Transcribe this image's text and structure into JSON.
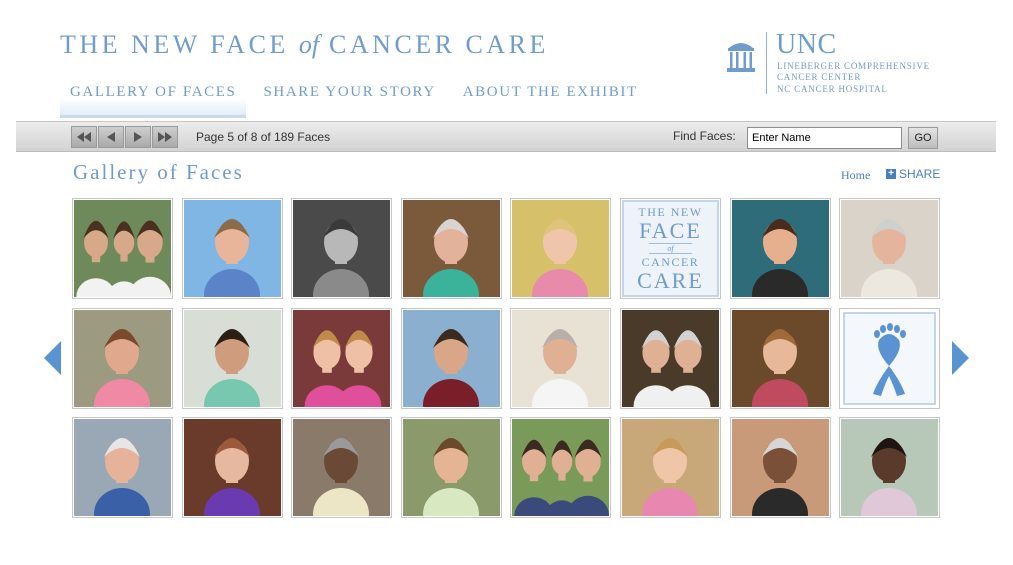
{
  "header": {
    "title_part1": "THE NEW FACE ",
    "title_of": "of",
    "title_part2": " CANCER CARE",
    "nav": [
      {
        "label": "GALLERY OF FACES",
        "active": true
      },
      {
        "label": "SHARE YOUR STORY",
        "active": false
      },
      {
        "label": "ABOUT THE EXHIBIT",
        "active": false
      }
    ],
    "logo": {
      "name": "UNC",
      "line1": "LINEBERGER COMPREHENSIVE",
      "line2": "CANCER CENTER",
      "line3": "NC CANCER HOSPITAL",
      "icon": "old-well-icon"
    }
  },
  "toolbar": {
    "page_info": "Page 5 of 8 of 189 Faces",
    "find_label": "Find Faces:",
    "find_value": "Enter Name",
    "go_label": "GO"
  },
  "content": {
    "heading": "Gallery of Faces",
    "home_link": "Home",
    "share_link": "SHARE"
  },
  "colors": {
    "accent": "#6f9bcd",
    "link": "#4a7fbf",
    "toolbar": "#dcdcdc"
  },
  "gallery": {
    "rows": 3,
    "columns": 8,
    "tiles": [
      {
        "type": "photo",
        "bg": "#6f8a5a",
        "skin": "#d7a98a",
        "hair": "#4a3020",
        "shirt": "#f2f2f2",
        "people": 3
      },
      {
        "type": "photo",
        "bg": "#7fb6e3",
        "skin": "#e8b49a",
        "hair": "#8a6b4a",
        "shirt": "#5b84c8"
      },
      {
        "type": "photo",
        "bg": "#4a4a4a",
        "skin": "#b8b8b8",
        "hair": "#3a3a3a",
        "shirt": "#8a8a8a"
      },
      {
        "type": "photo",
        "bg": "#7a5a3a",
        "skin": "#e3b29a",
        "hair": "#d9d4cf",
        "shirt": "#3ab39a"
      },
      {
        "type": "photo",
        "bg": "#d6c06a",
        "skin": "#f0c6aa",
        "hair": "#e1c27a",
        "shirt": "#e88aaa"
      },
      {
        "type": "logo",
        "line1": "THE NEW",
        "line2": "FACE",
        "line3": "of",
        "line4": "CANCER",
        "line5": "CARE"
      },
      {
        "type": "photo",
        "bg": "#2f6c7a",
        "skin": "#e6b08e",
        "hair": "#4a2c1c",
        "shirt": "#2a2a2a"
      },
      {
        "type": "photo",
        "bg": "#d9d3c9",
        "skin": "#e4b59c",
        "hair": "#cfcfcf",
        "shirt": "#ece8df"
      },
      {
        "type": "photo",
        "bg": "#9c9a80",
        "skin": "#e0a98e",
        "hair": "#7a4a2c",
        "shirt": "#f08aa4"
      },
      {
        "type": "photo",
        "bg": "#d8ddd6",
        "skin": "#cf9d7e",
        "hair": "#2c1e14",
        "shirt": "#78c8b0"
      },
      {
        "type": "photo",
        "bg": "#7a3a3a",
        "skin": "#f0c0a6",
        "hair": "#c08a4a",
        "shirt": "#e0509a",
        "people": 2
      },
      {
        "type": "photo",
        "bg": "#8bb0cf",
        "skin": "#d9a688",
        "hair": "#3a2a20",
        "shirt": "#7a1e2a"
      },
      {
        "type": "photo",
        "bg": "#e8e2d4",
        "skin": "#e0b094",
        "hair": "#b8b0a8",
        "shirt": "#f5f5f5"
      },
      {
        "type": "photo",
        "bg": "#4a3a2a",
        "skin": "#e0b094",
        "hair": "#d2d2d2",
        "shirt": "#f0f0f0",
        "people": 2
      },
      {
        "type": "photo",
        "bg": "#6a4a2a",
        "skin": "#e8b89a",
        "hair": "#a06a3a",
        "shirt": "#c04a60"
      },
      {
        "type": "ribbon",
        "color": "#5a93d1"
      },
      {
        "type": "photo",
        "bg": "#9aa8b6",
        "skin": "#e6b29a",
        "hair": "#e6e6e6",
        "shirt": "#3a60a8"
      },
      {
        "type": "photo",
        "bg": "#6a3a2a",
        "skin": "#e6b8a0",
        "hair": "#9a5a3a",
        "shirt": "#6a3ab0"
      },
      {
        "type": "photo",
        "bg": "#8a7a6a",
        "skin": "#6a4a36",
        "hair": "#9a9a9a",
        "shirt": "#ece6c6"
      },
      {
        "type": "photo",
        "bg": "#8a9a6a",
        "skin": "#e4b494",
        "hair": "#6a4a2a",
        "shirt": "#d8e8c0"
      },
      {
        "type": "photo",
        "bg": "#7a9a5a",
        "skin": "#e0b094",
        "hair": "#3a2a20",
        "shirt": "#3a4a7a",
        "people": 3
      },
      {
        "type": "photo",
        "bg": "#c8a878",
        "skin": "#f0c6a8",
        "hair": "#c89a5a",
        "shirt": "#e888b0"
      },
      {
        "type": "photo",
        "bg": "#c89a7a",
        "skin": "#7a5038",
        "hair": "#d6d6d6",
        "shirt": "#2a2a2a"
      },
      {
        "type": "photo",
        "bg": "#b8c8b8",
        "skin": "#5a3a2a",
        "hair": "#1e1410",
        "shirt": "#e0c8d8"
      }
    ]
  }
}
